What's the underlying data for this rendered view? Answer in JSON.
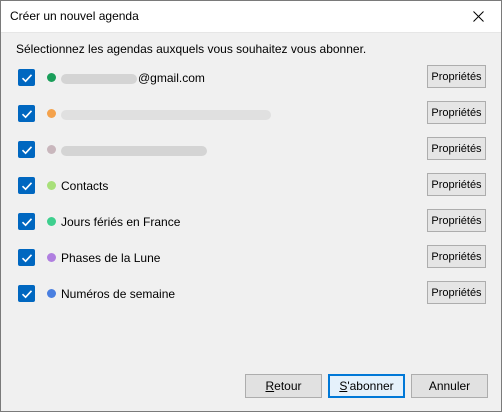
{
  "window": {
    "title": "Créer un nouvel agenda",
    "close_icon": "close-icon"
  },
  "instruction": "Sélectionnez les agendas auxquels vous souhaitez vous abonner.",
  "colors": {
    "checkbox": "#0067c0",
    "primary_border": "#0078d7"
  },
  "calendars": [
    {
      "label": "@gmail.com",
      "label_redacted_prefix": true,
      "color": "#1a9e5a",
      "checked": true,
      "button": "Propriétés"
    },
    {
      "label": "",
      "redacted": true,
      "color": "#f4a24c",
      "checked": true,
      "button": "Propriétés"
    },
    {
      "label": "",
      "redacted": true,
      "color": "#c9b7bd",
      "checked": true,
      "button": "Propriétés"
    },
    {
      "label": "Contacts",
      "color": "#a8e07a",
      "checked": true,
      "button": "Propriétés"
    },
    {
      "label": "Jours fériés en France",
      "color": "#3ecf8e",
      "checked": true,
      "button": "Propriétés"
    },
    {
      "label": "Phases de la Lune",
      "color": "#b07fe0",
      "checked": true,
      "button": "Propriétés"
    },
    {
      "label": "Numéros de semaine",
      "color": "#4a7fe0",
      "checked": true,
      "button": "Propriétés"
    }
  ],
  "footer": {
    "back_first": "R",
    "back_rest": "etour",
    "subscribe_first": "S",
    "subscribe_rest": "'abonner",
    "cancel": "Annuler"
  }
}
